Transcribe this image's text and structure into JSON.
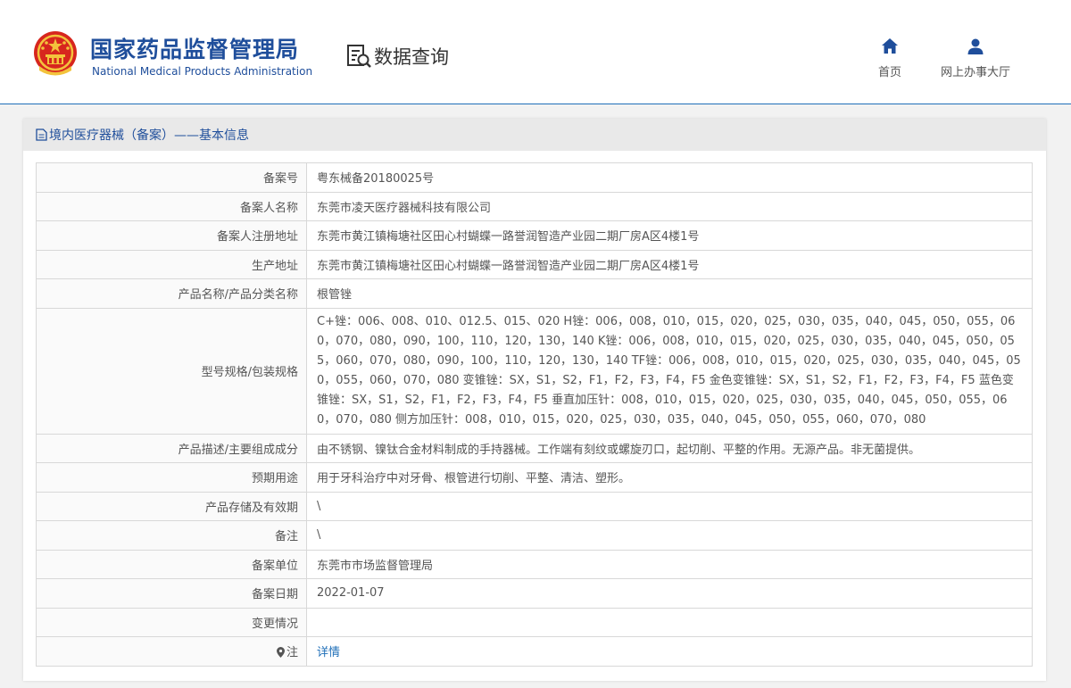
{
  "header": {
    "brand_cn": "国家药品监督管理局",
    "brand_en": "National Medical Products Administration",
    "query_title": "数据查询",
    "nav": [
      {
        "label": "首页",
        "icon": "home-icon"
      },
      {
        "label": "网上办事大厅",
        "icon": "user-icon"
      }
    ]
  },
  "card": {
    "title": "境内医疗器械（备案）——基本信息"
  },
  "rows": [
    {
      "label": "备案号",
      "value": "粤东械备20180025号"
    },
    {
      "label": "备案人名称",
      "value": "东莞市凌天医疗器械科技有限公司"
    },
    {
      "label": "备案人注册地址",
      "value": "东莞市黄江镇梅塘社区田心村蝴蝶一路誉润智造产业园二期厂房A区4楼1号"
    },
    {
      "label": "生产地址",
      "value": "东莞市黄江镇梅塘社区田心村蝴蝶一路誉润智造产业园二期厂房A区4楼1号"
    },
    {
      "label": "产品名称/产品分类名称",
      "value": "根管锉"
    },
    {
      "label": "型号规格/包装规格",
      "value": "C+锉：006、008、010、012.5、015、020 H锉：006，008，010，015，020，025，030，035，040，045，050，055，060，070，080，090，100，110，120，130，140 K锉：006，008，010，015，020，025，030，035，040，045，050，055，060，070，080，090，100，110，120，130，140 TF锉：006，008，010，015，020，025，030，035，040，045，050，055，060，070，080 变锥锉：SX，S1，S2，F1，F2，F3，F4，F5 金色变锥锉：SX，S1，S2，F1，F2，F3，F4，F5 蓝色变锥锉：SX，S1，S2，F1，F2，F3，F4，F5 垂直加压针：008，010，015，020，025，030，035，040，045，050，055，060，070，080 侧方加压针：008，010，015，020，025，030，035，040，045，050，055，060，070，080"
    },
    {
      "label": "产品描述/主要组成成分",
      "value": "由不锈钢、镍钛合金材料制成的手持器械。工作端有刻纹或螺旋刃口，起切削、平整的作用。无源产品。非无菌提供。"
    },
    {
      "label": "预期用途",
      "value": "用于牙科治疗中对牙骨、根管进行切削、平整、清洁、塑形。"
    },
    {
      "label": "产品存储及有效期",
      "value": "\\"
    },
    {
      "label": "备注",
      "value": "\\"
    },
    {
      "label": "备案单位",
      "value": "东莞市市场监督管理局"
    },
    {
      "label": "备案日期",
      "value": "2022-01-07"
    },
    {
      "label": "变更情况",
      "value": ""
    },
    {
      "label": "注",
      "value": "详情"
    }
  ]
}
